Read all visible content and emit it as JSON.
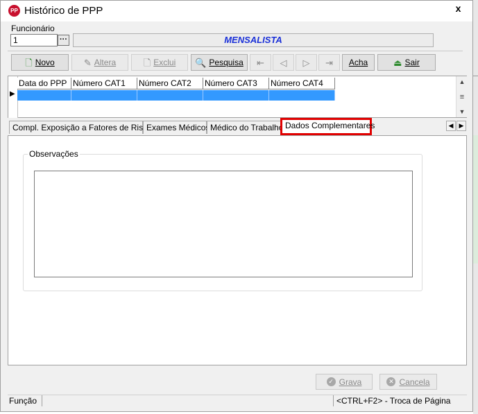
{
  "window": {
    "title": "Histórico de PPP",
    "icon_text": "PP",
    "close_label": "x"
  },
  "employee": {
    "label": "Funcionário",
    "id_value": "1",
    "ellipsis_label": "···",
    "category": "MENSALISTA"
  },
  "toolbar": {
    "novo": "Novo",
    "altera": "Altera",
    "exclui": "Exclui",
    "pesquisa": "Pesquisa",
    "acha": "Acha",
    "sair": "Sair"
  },
  "grid": {
    "columns": [
      "Data do PPP",
      "Número CAT1",
      "Número CAT2",
      "Número CAT3",
      "Número CAT4"
    ]
  },
  "tabs": [
    {
      "label": "Compl. Exposição a Fatores de Riscos"
    },
    {
      "label": "Exames Médicos"
    },
    {
      "label": "Médico do Trabalho"
    },
    {
      "label": "Dados Complementares",
      "active": true
    }
  ],
  "panel": {
    "observations_label": "Observações",
    "observations_value": ""
  },
  "actions": {
    "grava": "Grava",
    "cancela": "Cancela"
  },
  "status": {
    "function_label": "Função",
    "hint": "<CTRL+F2> - Troca de Página"
  },
  "colors": {
    "accent_text": "#1a30d8",
    "selected_row": "#3399ff",
    "active_tab_border": "#e00000",
    "app_icon": "#c8102e"
  }
}
